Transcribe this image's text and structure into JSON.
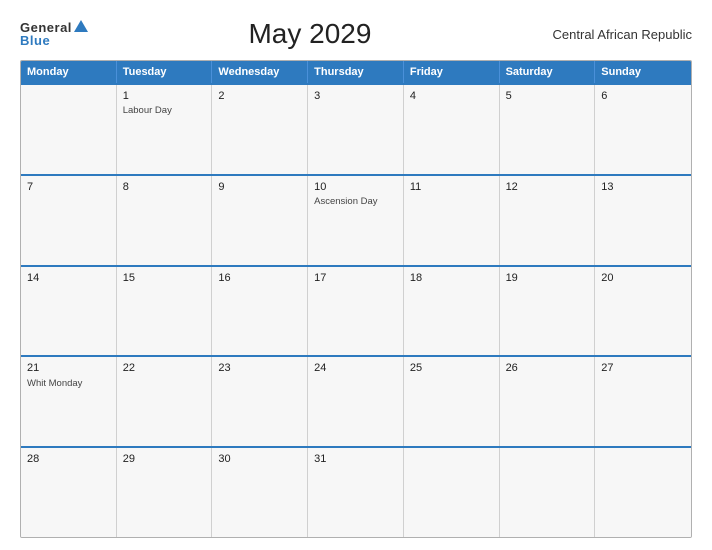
{
  "logo": {
    "general": "General",
    "blue": "Blue"
  },
  "title": "May 2029",
  "region": "Central African Republic",
  "header_days": [
    "Monday",
    "Tuesday",
    "Wednesday",
    "Thursday",
    "Friday",
    "Saturday",
    "Sunday"
  ],
  "weeks": [
    [
      {
        "num": "",
        "event": ""
      },
      {
        "num": "1",
        "event": "Labour Day"
      },
      {
        "num": "2",
        "event": ""
      },
      {
        "num": "3",
        "event": ""
      },
      {
        "num": "4",
        "event": ""
      },
      {
        "num": "5",
        "event": ""
      },
      {
        "num": "6",
        "event": ""
      }
    ],
    [
      {
        "num": "7",
        "event": ""
      },
      {
        "num": "8",
        "event": ""
      },
      {
        "num": "9",
        "event": ""
      },
      {
        "num": "10",
        "event": "Ascension Day"
      },
      {
        "num": "11",
        "event": ""
      },
      {
        "num": "12",
        "event": ""
      },
      {
        "num": "13",
        "event": ""
      }
    ],
    [
      {
        "num": "14",
        "event": ""
      },
      {
        "num": "15",
        "event": ""
      },
      {
        "num": "16",
        "event": ""
      },
      {
        "num": "17",
        "event": ""
      },
      {
        "num": "18",
        "event": ""
      },
      {
        "num": "19",
        "event": ""
      },
      {
        "num": "20",
        "event": ""
      }
    ],
    [
      {
        "num": "21",
        "event": "Whit Monday"
      },
      {
        "num": "22",
        "event": ""
      },
      {
        "num": "23",
        "event": ""
      },
      {
        "num": "24",
        "event": ""
      },
      {
        "num": "25",
        "event": ""
      },
      {
        "num": "26",
        "event": ""
      },
      {
        "num": "27",
        "event": ""
      }
    ],
    [
      {
        "num": "28",
        "event": ""
      },
      {
        "num": "29",
        "event": ""
      },
      {
        "num": "30",
        "event": ""
      },
      {
        "num": "31",
        "event": ""
      },
      {
        "num": "",
        "event": ""
      },
      {
        "num": "",
        "event": ""
      },
      {
        "num": "",
        "event": ""
      }
    ]
  ]
}
